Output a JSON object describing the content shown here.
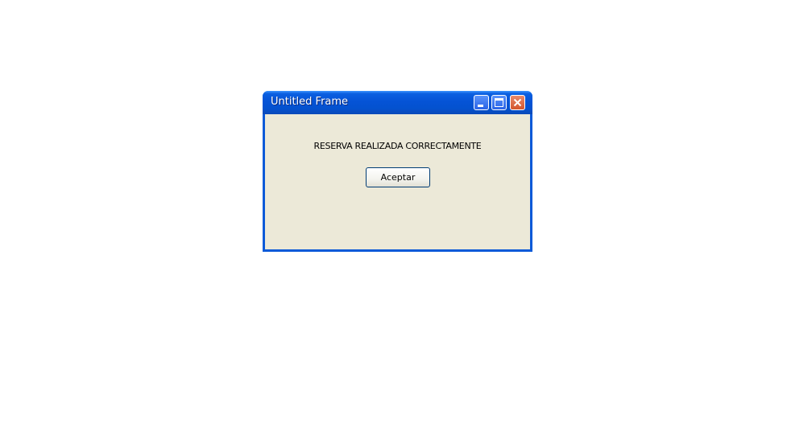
{
  "window": {
    "title": "Untitled Frame",
    "controls": {
      "minimize_icon": "minimize-icon",
      "maximize_icon": "maximize-icon",
      "close_icon": "close-icon"
    }
  },
  "dialog": {
    "message": "RESERVA REALIZADA CORRECTAMENTE",
    "accept_label": "Aceptar"
  },
  "colors": {
    "titlebar": "#0553d6",
    "frame_border": "#0a5ad8",
    "client_background": "#ece9d8",
    "close_button": "#d3552d",
    "button_border": "#003c74"
  }
}
